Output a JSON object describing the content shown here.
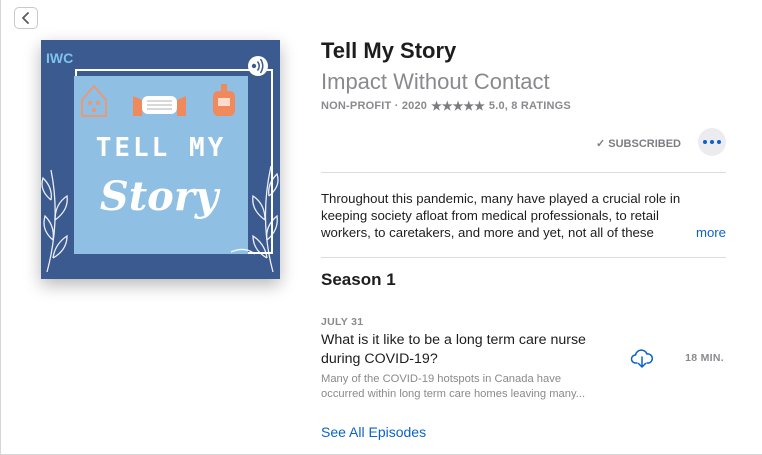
{
  "window": {
    "back_icon": "chevron-left-icon"
  },
  "artwork": {
    "badge": "IWC",
    "line1": "TELL MY",
    "line2": "Story",
    "colors": {
      "outer": "#3b5a8f",
      "inner": "#8fbfe2",
      "text": "#ffffff",
      "accent": "#f08a5d"
    }
  },
  "podcast": {
    "title": "Tell My Story",
    "author": "Impact Without Contact",
    "category_year": "NON-PROFIT · 2020",
    "stars": "★★★★★",
    "rating": "5.0, 8 RATINGS",
    "subscribed_label": "✓ SUBSCRIBED",
    "description_lines": [
      "Throughout this pandemic, many have played a crucial role in",
      "keeping society afloat from medical professionals, to retail",
      "workers, to caretakers, and more and yet, not all of these"
    ],
    "more_label": "more"
  },
  "season": {
    "title": "Season 1"
  },
  "episode": {
    "date": "JULY 31",
    "title": "What is it like to be a long term care nurse during COVID-19?",
    "description_lines": [
      "Many of the COVID-19 hotspots in Canada have",
      "occurred within long term care homes leaving many..."
    ],
    "duration": "18 MIN.",
    "download_icon": "cloud-download-icon"
  },
  "see_all_label": "See All Episodes",
  "accent_color": "#0a63c9"
}
